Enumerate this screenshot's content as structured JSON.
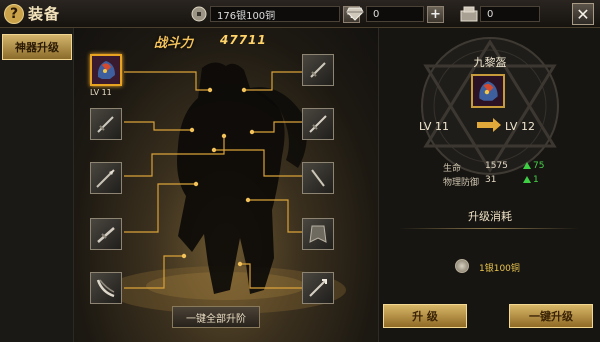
{
  "header": {
    "title": "装备",
    "currency_silver": "176银100铜",
    "currency_diamond": "0",
    "currency_ticket": "0"
  },
  "sidebar": {
    "tabs": [
      {
        "label": "神器升级",
        "active": true
      }
    ]
  },
  "equipment": {
    "power_label": "战斗力",
    "power_value": "47711",
    "selected_slot_level": "LV 11",
    "upgrade_all_label": "一键全部升阶"
  },
  "detail": {
    "item_name": "九黎盔",
    "level_from": "LV 11",
    "level_to": "LV 12",
    "stats": [
      {
        "name": "生命",
        "value": "1575",
        "gain": "75"
      },
      {
        "name": "物理防御",
        "value": "31",
        "gain": "1"
      }
    ],
    "cost_title": "升级消耗",
    "cost_value": "1银100铜",
    "upgrade_label": "升 级",
    "upgrade_one_click_label": "一键升级"
  },
  "colors": {
    "accent_gold": "#e8a321",
    "stat_gain_green": "#46d24a",
    "cost_text": "#e8c44e"
  }
}
